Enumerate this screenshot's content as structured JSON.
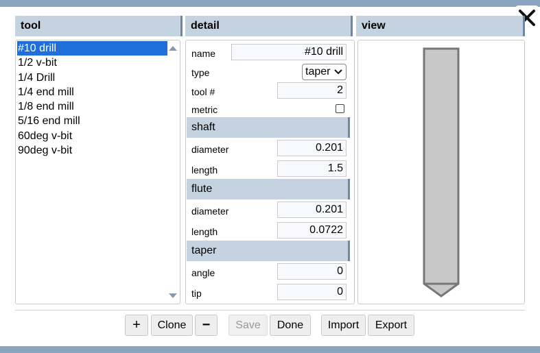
{
  "headers": {
    "tool": "tool",
    "detail": "detail",
    "view": "view"
  },
  "tools": [
    "#10 drill",
    "1/2 v-bit",
    "1/4 Drill",
    "1/4 end mill",
    "1/8 end mill",
    "5/16 end mill",
    "60deg v-bit",
    "90deg v-bit"
  ],
  "selected_tool_index": 0,
  "detail": {
    "name_label": "name",
    "name_value": "#10 drill",
    "type_label": "type",
    "type_value": "taper",
    "toolnum_label": "tool #",
    "toolnum_value": "2",
    "metric_label": "metric",
    "metric_checked": false,
    "shaft_section": "shaft",
    "shaft_diameter_label": "diameter",
    "shaft_diameter_value": "0.201",
    "shaft_length_label": "length",
    "shaft_length_value": "1.5",
    "flute_section": "flute",
    "flute_diameter_label": "diameter",
    "flute_diameter_value": "0.201",
    "flute_length_label": "length",
    "flute_length_value": "0.0722",
    "taper_section": "taper",
    "taper_angle_label": "angle",
    "taper_angle_value": "0",
    "taper_tip_label": "tip",
    "taper_tip_value": "0"
  },
  "buttons": {
    "add": "+",
    "clone": "Clone",
    "remove": "−",
    "save": "Save",
    "done": "Done",
    "import": "Import",
    "export": "Export"
  },
  "colors": {
    "header_bg": "#c5d2e0",
    "header_accent": "#6e87a6",
    "selected": "#1e6fd9",
    "frame": "#8aa4c0",
    "tool_fill": "#c8c8c8",
    "tool_stroke": "#777777"
  },
  "icons": {
    "close": "close-icon",
    "scroll_up": "scroll-up-icon",
    "scroll_down": "scroll-down-icon",
    "dropdown": "chevron-down-icon"
  }
}
